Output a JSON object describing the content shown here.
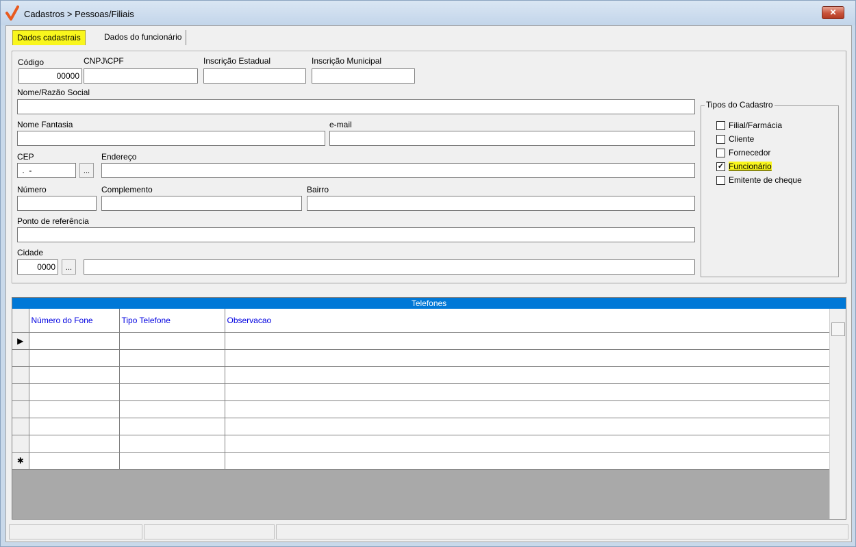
{
  "window": {
    "title": "Cadastros > Pessoas/Filiais",
    "close_label": "✕"
  },
  "tabs": [
    {
      "label": "Dados cadastrais",
      "active": true
    },
    {
      "label": "Dados do funcionário",
      "active": false
    }
  ],
  "form": {
    "codigo": {
      "label": "Código",
      "value": "00000"
    },
    "cnpj": {
      "label": "CNPJ\\CPF",
      "value": ""
    },
    "insc_estadual": {
      "label": "Inscrição Estadual",
      "value": ""
    },
    "insc_municipal": {
      "label": "Inscrição Municipal",
      "value": ""
    },
    "nome_razao": {
      "label": "Nome/Razão Social",
      "value": ""
    },
    "nome_fantasia": {
      "label": "Nome Fantasia",
      "value": ""
    },
    "email": {
      "label": "e-mail",
      "value": ""
    },
    "cep": {
      "label": "CEP",
      "value": " .  -"
    },
    "endereco": {
      "label": "Endereço",
      "value": ""
    },
    "numero": {
      "label": "Número",
      "value": ""
    },
    "complemento": {
      "label": "Complemento",
      "value": ""
    },
    "bairro": {
      "label": "Bairro",
      "value": ""
    },
    "ponto_ref": {
      "label": "Ponto de referência",
      "value": ""
    },
    "cidade": {
      "label": "Cidade",
      "code": "0000",
      "name": ""
    },
    "lookup_label": "..."
  },
  "tipos_cadastro": {
    "title": "Tipos do Cadastro",
    "options": [
      {
        "label": "Filial/Farmácia",
        "checked": false
      },
      {
        "label": "Cliente",
        "checked": false
      },
      {
        "label": "Fornecedor",
        "checked": false
      },
      {
        "label": "Funcionário",
        "checked": true
      },
      {
        "label": "Emitente de cheque",
        "checked": false
      }
    ]
  },
  "telefones": {
    "caption": "Telefones",
    "columns": [
      "Número do Fone",
      "Tipo Telefone",
      "Observacao"
    ],
    "current_marker": "▶",
    "new_marker": "✱"
  },
  "colors": {
    "accent_yellow": "#f9f61d",
    "grid_caption": "#0078d7",
    "column_header_text": "#0000e0"
  }
}
